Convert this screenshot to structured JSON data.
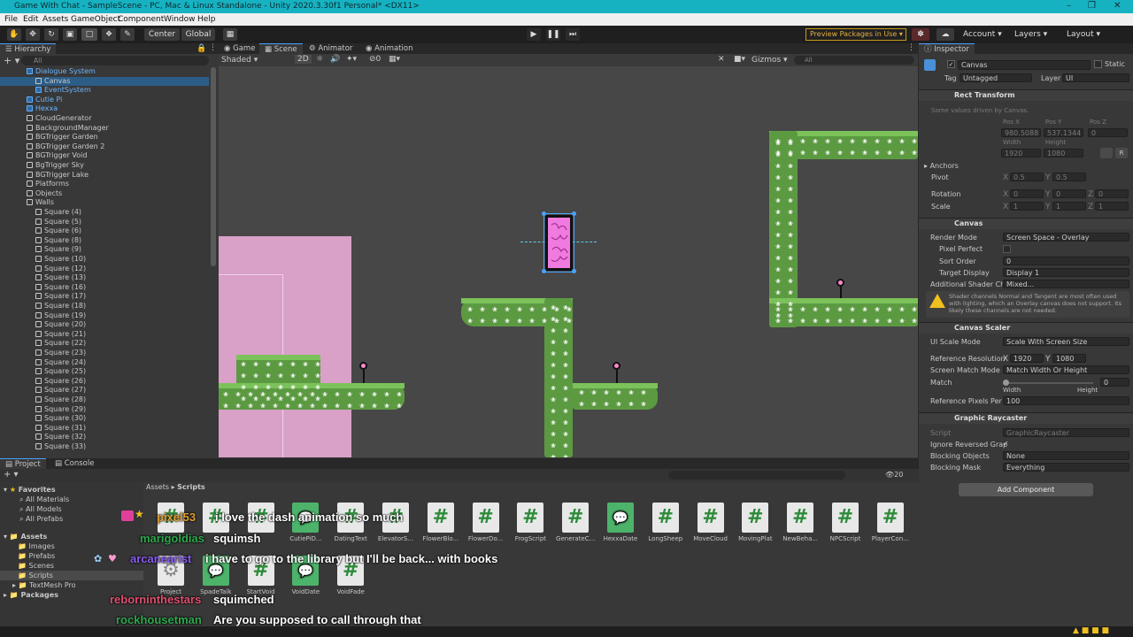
{
  "window": {
    "title": "Game With Chat - SampleScene - PC, Mac & Linux Standalone - Unity 2020.3.30f1 Personal* <DX11>"
  },
  "menu": [
    "File",
    "Edit",
    "Assets",
    "GameObject",
    "Component",
    "Window",
    "Help"
  ],
  "toolbar": {
    "pivot": "Center",
    "space": "Global",
    "preview_packages": "Preview Packages in Use",
    "account": "Account",
    "layers": "Layers",
    "layout": "Layout"
  },
  "hierarchy": {
    "title": "Hierarchy",
    "search_placeholder": "All",
    "items": [
      {
        "label": "Dialogue System",
        "indent": 1,
        "blue": true
      },
      {
        "label": "Canvas",
        "indent": 2,
        "selected": true
      },
      {
        "label": "EventSystem",
        "indent": 2,
        "blue": true
      },
      {
        "label": "Cutie Pi",
        "indent": 1,
        "blue": true
      },
      {
        "label": "Hexxa",
        "indent": 1,
        "blue": true
      },
      {
        "label": "CloudGenerator",
        "indent": 1
      },
      {
        "label": "BackgroundManager",
        "indent": 1
      },
      {
        "label": "BGTrigger Garden",
        "indent": 1
      },
      {
        "label": "BGTrigger Garden 2",
        "indent": 1
      },
      {
        "label": "BGTrigger Void",
        "indent": 1
      },
      {
        "label": "BgTrigger Sky",
        "indent": 1
      },
      {
        "label": "BGTrigger Lake",
        "indent": 1
      },
      {
        "label": "Platforms",
        "indent": 1
      },
      {
        "label": "Objects",
        "indent": 1
      },
      {
        "label": "Walls",
        "indent": 1
      },
      {
        "label": "Square (4)",
        "indent": 2
      },
      {
        "label": "Square (5)",
        "indent": 2
      },
      {
        "label": "Square (6)",
        "indent": 2
      },
      {
        "label": "Square (8)",
        "indent": 2
      },
      {
        "label": "Square (9)",
        "indent": 2
      },
      {
        "label": "Square (10)",
        "indent": 2
      },
      {
        "label": "Square (12)",
        "indent": 2
      },
      {
        "label": "Square (13)",
        "indent": 2
      },
      {
        "label": "Square (16)",
        "indent": 2
      },
      {
        "label": "Square (17)",
        "indent": 2
      },
      {
        "label": "Square (18)",
        "indent": 2
      },
      {
        "label": "Square (19)",
        "indent": 2
      },
      {
        "label": "Square (20)",
        "indent": 2
      },
      {
        "label": "Square (21)",
        "indent": 2
      },
      {
        "label": "Square (22)",
        "indent": 2
      },
      {
        "label": "Square (23)",
        "indent": 2
      },
      {
        "label": "Square (24)",
        "indent": 2
      },
      {
        "label": "Square (25)",
        "indent": 2
      },
      {
        "label": "Square (26)",
        "indent": 2
      },
      {
        "label": "Square (27)",
        "indent": 2
      },
      {
        "label": "Square (28)",
        "indent": 2
      },
      {
        "label": "Square (29)",
        "indent": 2
      },
      {
        "label": "Square (30)",
        "indent": 2
      },
      {
        "label": "Square (31)",
        "indent": 2
      },
      {
        "label": "Square (32)",
        "indent": 2
      },
      {
        "label": "Square (33)",
        "indent": 2
      }
    ]
  },
  "scene_tabs": {
    "game": "Game",
    "scene": "Scene",
    "animator": "Animator",
    "animation": "Animation"
  },
  "scene_bar": {
    "shading": "Shaded",
    "mode2d": "2D",
    "layer_count": "0",
    "gizmos": "Gizmos",
    "search_placeholder": "All"
  },
  "inspector": {
    "title": "Inspector",
    "object_name": "Canvas",
    "static_label": "Static",
    "tag_label": "Tag",
    "tag_value": "Untagged",
    "layer_label": "Layer",
    "layer_value": "UI",
    "rect_transform": "Rect Transform",
    "driven_note": "Some values driven by Canvas.",
    "pos_x_label": "Pos X",
    "pos_y_label": "Pos Y",
    "pos_z_label": "Pos Z",
    "pos_x": "980.5088",
    "pos_y": "537.1344",
    "pos_z": "0",
    "width_label": "Width",
    "height_label": "Height",
    "width": "1920",
    "height": "1080",
    "anchors": "Anchors",
    "pivot_label": "Pivot",
    "pivot_x": "0.5",
    "pivot_y": "0.5",
    "rotation_label": "Rotation",
    "rot_x": "0",
    "rot_y": "0",
    "rot_z": "0",
    "scale_label": "Scale",
    "scale_x": "1",
    "scale_y": "1",
    "scale_z": "1",
    "canvas": "Canvas",
    "render_mode_label": "Render Mode",
    "render_mode": "Screen Space - Overlay",
    "pixel_perfect_label": "Pixel Perfect",
    "sort_order_label": "Sort Order",
    "sort_order": "0",
    "target_display_label": "Target Display",
    "target_display": "Display 1",
    "shader_channels_label": "Additional Shader Cha",
    "shader_channels": "Mixed...",
    "warning": "Shader channels Normal and Tangent are most often used with lighting, which an Overlay canvas does not support. Its likely these channels are not needed.",
    "canvas_scaler": "Canvas Scaler",
    "ui_scale_label": "UI Scale Mode",
    "ui_scale": "Scale With Screen Size",
    "ref_res_label": "Reference Resolution",
    "ref_x": "1920",
    "ref_y": "1080",
    "screen_match_label": "Screen Match Mode",
    "screen_match": "Match Width Or Height",
    "match_label": "Match",
    "match_value": "0",
    "match_width": "Width",
    "match_height": "Height",
    "ref_ppu_label": "Reference Pixels Per U",
    "ref_ppu": "100",
    "graphic_raycaster": "Graphic Raycaster",
    "script_label": "Script",
    "script_value": "GraphicRaycaster",
    "ignore_reversed_label": "Ignore Reversed Grap",
    "blocking_objects_label": "Blocking Objects",
    "blocking_objects": "None",
    "blocking_mask_label": "Blocking Mask",
    "blocking_mask": "Everything",
    "add_component": "Add Component"
  },
  "project": {
    "tab_project": "Project",
    "tab_console": "Console",
    "favorites": "Favorites",
    "fav_items": [
      "All Materials",
      "All Models",
      "All Prefabs"
    ],
    "assets": "Assets",
    "asset_folders": [
      "Images",
      "Prefabs",
      "Scenes",
      "Scripts",
      "TextMesh Pro"
    ],
    "packages": "Packages",
    "breadcrumb_root": "Assets",
    "breadcrumb_current": "Scripts",
    "hidden_count": "20",
    "scripts_row1": [
      {
        "name": "",
        "type": "cs"
      },
      {
        "name": "",
        "type": "cs"
      },
      {
        "name": "",
        "type": "cs"
      },
      {
        "name": "CutiePiD...",
        "type": "chat"
      },
      {
        "name": "DatingText",
        "type": "cs"
      },
      {
        "name": "ElevatorS...",
        "type": "cs"
      },
      {
        "name": "FlowerBlo...",
        "type": "cs"
      },
      {
        "name": "FlowerDo...",
        "type": "cs"
      },
      {
        "name": "FrogScript",
        "type": "cs"
      },
      {
        "name": "GenerateC...",
        "type": "cs"
      },
      {
        "name": "HexxaDate",
        "type": "chat"
      },
      {
        "name": "LongSheep",
        "type": "cs"
      },
      {
        "name": "MoveCloud",
        "type": "cs"
      },
      {
        "name": "MovingPlat",
        "type": "cs"
      },
      {
        "name": "NewBeha...",
        "type": "cs"
      },
      {
        "name": "NPCScript",
        "type": "cs"
      },
      {
        "name": "PlayerCon...",
        "type": "cs"
      }
    ],
    "scripts_row2": [
      {
        "name": "Project",
        "type": "gear"
      },
      {
        "name": "SpadeTalk",
        "type": "chat"
      },
      {
        "name": "StartVoid",
        "type": "cs"
      },
      {
        "name": "VoidDate",
        "type": "chat"
      },
      {
        "name": "VoidFade",
        "type": "cs"
      }
    ]
  },
  "chat": [
    {
      "user": "pixel53",
      "text": "i love the dash animation so much",
      "user_color": "#e0a030"
    },
    {
      "user": "marigoldias",
      "text": "squimsh",
      "user_color": "#2fa84f"
    },
    {
      "user": "arcanearist",
      "text": "i have to go to the library but I'll be back... with books",
      "user_color": "#8a5cf0"
    },
    {
      "user": "reborninthestars",
      "text": "squimched",
      "user_color": "#e05070"
    },
    {
      "user": "rockhousetman",
      "text": "Are you supposed to call through that",
      "user_color": "#2fa84f"
    }
  ],
  "colors": {
    "accent": "#17b2c1",
    "grass": "#5c9a42",
    "pink_block": "#d9a0c8",
    "selected_row": "#2c5d87"
  }
}
